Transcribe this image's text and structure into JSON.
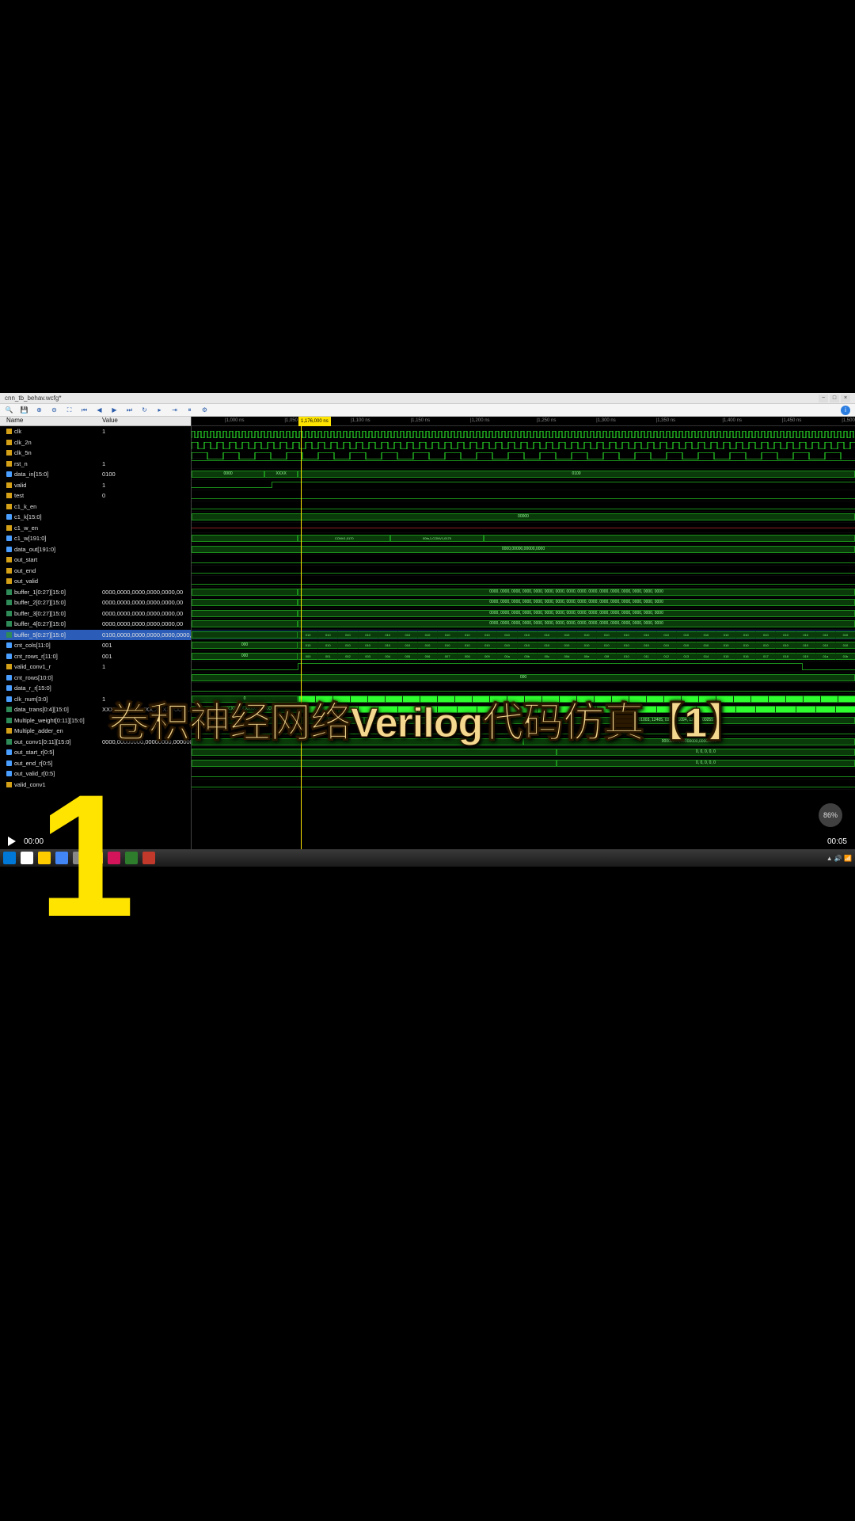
{
  "overlay": {
    "title": "卷积神经网络Verilog代码仿真【1】",
    "episode": "1"
  },
  "badge": {
    "text": "86%"
  },
  "window": {
    "title": "cnn_tb_behav.wcfg*"
  },
  "video": {
    "current_time": "00:00",
    "total_time": "00:05"
  },
  "cursor": {
    "time": "1,176,000 ns"
  },
  "time_ticks": [
    {
      "pos": 5,
      "label": "1,000 ns"
    },
    {
      "pos": 14,
      "label": "1,050 ns"
    },
    {
      "pos": 24,
      "label": "1,100 ns"
    },
    {
      "pos": 33,
      "label": "1,150 ns"
    },
    {
      "pos": 42,
      "label": "1,200 ns"
    },
    {
      "pos": 52,
      "label": "1,250 ns"
    },
    {
      "pos": 61,
      "label": "1,300 ns"
    },
    {
      "pos": 70,
      "label": "1,350 ns"
    },
    {
      "pos": 80,
      "label": "1,400 ns"
    },
    {
      "pos": 89,
      "label": "1,450 ns"
    },
    {
      "pos": 98,
      "label": "1,500 ns"
    }
  ],
  "panel": {
    "name_header": "Name",
    "value_header": "Value"
  },
  "signals": [
    {
      "name": "clk",
      "value": "1",
      "icon": "bit",
      "wave": "clock"
    },
    {
      "name": "clk_2n",
      "value": "",
      "icon": "bit",
      "wave": "clock2"
    },
    {
      "name": "clk_5n",
      "value": "",
      "icon": "bit",
      "wave": "clock5"
    },
    {
      "name": "rst_n",
      "value": "1",
      "icon": "bit",
      "wave": "high"
    },
    {
      "name": "data_in[15:0]",
      "value": "0100",
      "icon": "bus",
      "wave": "bus_data"
    },
    {
      "name": "valid",
      "value": "1",
      "icon": "bit",
      "wave": "step_high"
    },
    {
      "name": "test",
      "value": "0",
      "icon": "bit",
      "wave": "low"
    },
    {
      "name": "c1_k_en",
      "value": "",
      "icon": "bit",
      "wave": "low"
    },
    {
      "name": "c1_k[15:0]",
      "value": "",
      "icon": "bus",
      "wave": "bus_c1k"
    },
    {
      "name": "c1_w_en",
      "value": "",
      "icon": "bit",
      "wave": "red"
    },
    {
      "name": "c1_w[191:0]",
      "value": "",
      "icon": "bus",
      "wave": "bus_c1w"
    },
    {
      "name": "data_out[191:0]",
      "value": "",
      "icon": "bus",
      "wave": "bus_out"
    },
    {
      "name": "out_start",
      "value": "",
      "icon": "bit",
      "wave": "low"
    },
    {
      "name": "out_end",
      "value": "",
      "icon": "bit",
      "wave": "low"
    },
    {
      "name": "out_valid",
      "value": "",
      "icon": "bit",
      "wave": "low"
    },
    {
      "name": "buffer_1[0:27][15:0]",
      "value": "0000,0000,0000,0000,0000,00",
      "icon": "arr",
      "wave": "buffer"
    },
    {
      "name": "buffer_2[0:27][15:0]",
      "value": "0000,0000,0000,0000,0000,00",
      "icon": "arr",
      "wave": "buffer"
    },
    {
      "name": "buffer_3[0:27][15:0]",
      "value": "0000,0000,0000,0000,0000,00",
      "icon": "arr",
      "wave": "buffer"
    },
    {
      "name": "buffer_4[0:27][15:0]",
      "value": "0000,0000,0000,0000,0000,00",
      "icon": "arr",
      "wave": "buffer"
    },
    {
      "name": "buffer_5[0:27][15:0]",
      "value": "0100,0000,0000,0000,0000,0000,00",
      "icon": "arr",
      "wave": "buffer_sel",
      "selected": true
    },
    {
      "name": "cnt_cols[11:0]",
      "value": "001",
      "icon": "bus",
      "wave": "cnt_cols"
    },
    {
      "name": "cnt_rows_r[11:0]",
      "value": "001",
      "icon": "bus",
      "wave": "cnt_rows"
    },
    {
      "name": "valid_conv1_r",
      "value": "1",
      "icon": "bit",
      "wave": "step_wide"
    },
    {
      "name": "cnt_rows[10:0]",
      "value": "",
      "icon": "bus",
      "wave": "bus_thin"
    },
    {
      "name": "data_r_r[15:0]",
      "value": "",
      "icon": "bus",
      "wave": "low"
    },
    {
      "name": "clk_num[3:0]",
      "value": "1",
      "icon": "bus",
      "wave": "clk_num"
    },
    {
      "name": "data_trans[0:4][15:0]",
      "value": "XXXX,XXXX,XXXX,XXXX,XXXX,XXXX,XXX",
      "icon": "arr",
      "wave": "data_trans"
    },
    {
      "name": "Multiple_weight[0:11][15:0]",
      "value": "",
      "icon": "arr",
      "wave": "mult_w"
    },
    {
      "name": "Multiple_adder_en",
      "value": "",
      "icon": "bit",
      "wave": "low"
    },
    {
      "name": "out_conv1[0:11][15:0]",
      "value": "0000,00000000,00000000,00000000",
      "icon": "arr",
      "wave": "out_conv"
    },
    {
      "name": "out_start_r[0:5]",
      "value": "",
      "icon": "bus",
      "wave": "out_r"
    },
    {
      "name": "out_end_r[0:5]",
      "value": "",
      "icon": "bus",
      "wave": "out_r"
    },
    {
      "name": "out_valid_r[0:5]",
      "value": "",
      "icon": "bus",
      "wave": "low"
    },
    {
      "name": "valid_conv1",
      "value": "",
      "icon": "bit",
      "wave": "low"
    }
  ],
  "bus_values": {
    "data_in_before": "0000",
    "data_in_mid": "XXXX",
    "data_in_after": "0100",
    "c1k_before": "00000",
    "c1w": "0000,00000,00000,0000",
    "buffer_pattern": "0000, 0000, 0000, 0000, 0000, 0000, 0000, 0000, 0000, 0000, 0000, 0000, 0000, 0000, 0000, 0000",
    "cnt_seq": [
      "000",
      "001",
      "002",
      "003",
      "004",
      "005",
      "006",
      "007",
      "008",
      "009",
      "00a",
      "00b",
      "00c",
      "00d",
      "00e",
      "00f",
      "010",
      "011",
      "012",
      "013",
      "014",
      "015",
      "016",
      "017",
      "018",
      "019",
      "01a",
      "01b"
    ],
    "out_conv_pattern": "01003, 12405, 03170, 1094, 12470, 00255",
    "out_r_pattern": "0, 0, 0, 0, 0"
  }
}
